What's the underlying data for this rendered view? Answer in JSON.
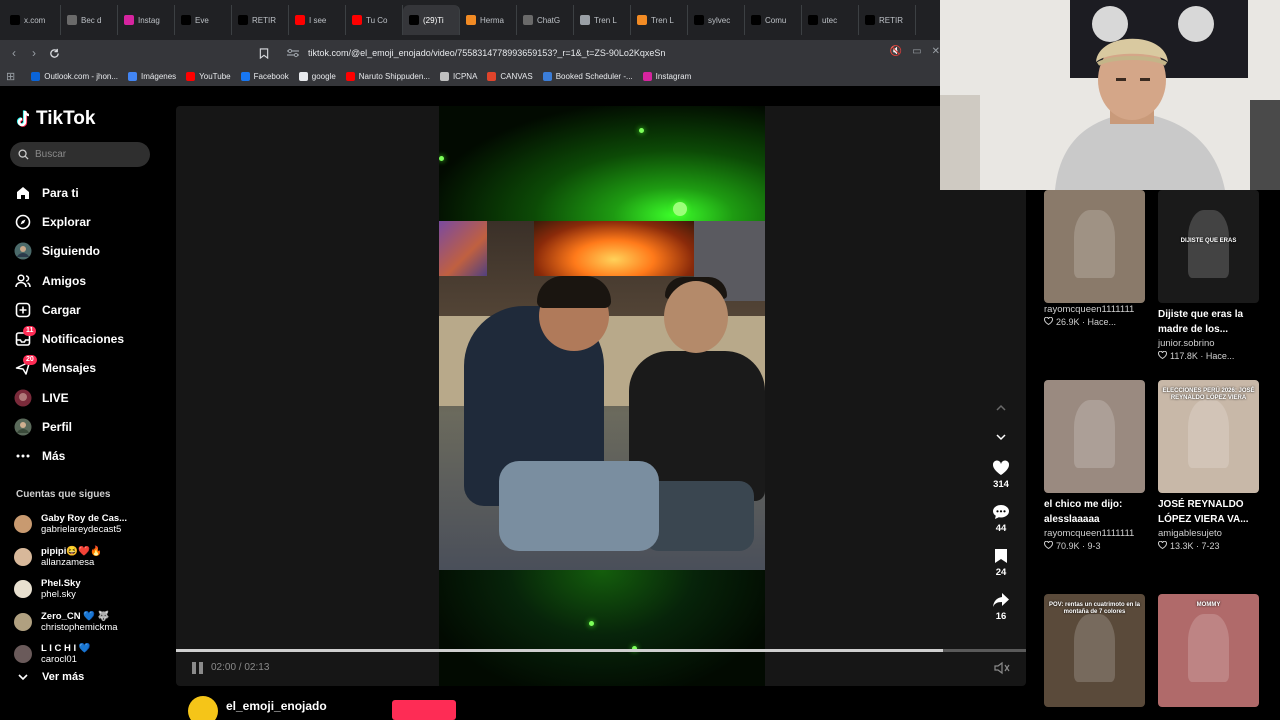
{
  "browser": {
    "tabs": [
      {
        "label": "x.com",
        "icon": "x-icon",
        "color": "#000000"
      },
      {
        "label": "Bec d",
        "icon": "doc-icon",
        "color": "#6a6a6a"
      },
      {
        "label": "Instag",
        "icon": "instagram-icon",
        "color": "#d6249f"
      },
      {
        "label": "Eve",
        "icon": "x-icon",
        "color": "#000000"
      },
      {
        "label": "RETIR",
        "icon": "x-icon",
        "color": "#000000"
      },
      {
        "label": "I see",
        "icon": "youtube-icon",
        "color": "#ff0000"
      },
      {
        "label": "Tu Co",
        "icon": "youtube-icon",
        "color": "#ff0000"
      },
      {
        "label": "(29)Ti",
        "icon": "tiktok-icon",
        "color": "#000000"
      },
      {
        "label": "Herma",
        "icon": "folder-icon",
        "color": "#f28b24"
      },
      {
        "label": "ChatG",
        "icon": "chatgpt-icon",
        "color": "#6a6a6a"
      },
      {
        "label": "Tren L",
        "icon": "chrome-icon",
        "color": "#9aa0a6"
      },
      {
        "label": "Tren L",
        "icon": "folder-icon",
        "color": "#f28b24"
      },
      {
        "label": "sylvec",
        "icon": "x-icon",
        "color": "#000000"
      },
      {
        "label": "Comu",
        "icon": "x-icon",
        "color": "#000000"
      },
      {
        "label": "utec",
        "icon": "x-icon",
        "color": "#000000"
      },
      {
        "label": "RETIR",
        "icon": "x-icon",
        "color": "#000000"
      }
    ],
    "url": "tiktok.com/@el_emoji_enojado/video/7558314778993659153?_r=1&_t=ZS-90Lo2KqxeSn",
    "bookmarks": [
      {
        "label": "Outlook.com - jhon...",
        "color": "#0a64d8"
      },
      {
        "label": "Imágenes",
        "color": "#4285f4"
      },
      {
        "label": "YouTube",
        "color": "#ff0000"
      },
      {
        "label": "Facebook",
        "color": "#1877f2"
      },
      {
        "label": "google",
        "color": "#e8eaed"
      },
      {
        "label": "Naruto Shippuden...",
        "color": "#ff0000"
      },
      {
        "label": "ICPNA",
        "color": "#c0c0c0"
      },
      {
        "label": "CANVAS",
        "color": "#e0442b"
      },
      {
        "label": "Booked Scheduler -...",
        "color": "#3b7dd8"
      },
      {
        "label": "Instagram",
        "color": "#d6249f"
      }
    ]
  },
  "sidebar": {
    "logo": "TikTok",
    "search_placeholder": "Buscar",
    "nav": [
      {
        "label": "Para ti",
        "icon": "home-icon"
      },
      {
        "label": "Explorar",
        "icon": "compass-icon"
      },
      {
        "label": "Siguiendo",
        "icon": "following-avatar-icon"
      },
      {
        "label": "Amigos",
        "icon": "friends-icon"
      },
      {
        "label": "Cargar",
        "icon": "upload-icon"
      },
      {
        "label": "Notificaciones",
        "icon": "inbox-icon",
        "badge": "11"
      },
      {
        "label": "Mensajes",
        "icon": "messages-icon",
        "badge": "20"
      },
      {
        "label": "LIVE",
        "icon": "live-icon"
      },
      {
        "label": "Perfil",
        "icon": "profile-icon"
      },
      {
        "label": "Más",
        "icon": "more-icon"
      }
    ],
    "following_title": "Cuentas que sigues",
    "following": [
      {
        "name": "Gaby Roy de Cas...",
        "handle": "gabrielareydecast5",
        "color": "#c89a70"
      },
      {
        "name": "pipipi😆❤️🔥",
        "handle": "allanzamesa",
        "color": "#d8b89a"
      },
      {
        "name": "Phel.Sky",
        "handle": "phel.sky",
        "color": "#e8e0d0"
      },
      {
        "name": "Zero_CN 💙 🐺",
        "handle": "christophemickma",
        "color": "#b0a080"
      },
      {
        "name": "L I C H I 💙",
        "handle": "carocl01",
        "color": "#6a5a5a"
      }
    ],
    "see_more": "Ver más"
  },
  "player": {
    "time": "02:00 / 02:13",
    "progress": 0.902,
    "author": "el_emoji_enojado",
    "likes": "314",
    "comments": "44",
    "saves": "24",
    "shares": "16"
  },
  "feed": [
    {
      "caption": "",
      "user": "rayomcqueen1111111",
      "meta": "26.9K · Hace...",
      "bg": "#8a7a6a"
    },
    {
      "caption": "Dijiste que eras la madre de los...",
      "user": "junior.sobrino",
      "meta": "117.8K · Hace...",
      "bg": "#1a1a1a",
      "overlay": "DIJISTE QUE ERAS"
    },
    {
      "caption": "el chico me dijo: alesslaaaaa",
      "user": "rayomcqueen1111111",
      "meta": "70.9K · 9-3",
      "bg": "#9a8a80"
    },
    {
      "caption": "JOSÉ REYNALDO LÓPEZ VIERA VA...",
      "user": "amigablesujeto",
      "meta": "13.3K · 7-23",
      "bg": "#c8b8a8",
      "overlay": "ELECCIONES PERÚ 2026: JOSÉ REYNALDO LÓPEZ VIERA"
    },
    {
      "caption": "",
      "user": "",
      "meta": "",
      "bg": "#5a4a3a",
      "overlay": "POV: rentas un cuatrimoto en la montaña de 7 colores"
    },
    {
      "caption": "",
      "user": "",
      "meta": "",
      "bg": "#b06a6a",
      "overlay": "MOMMY"
    }
  ]
}
